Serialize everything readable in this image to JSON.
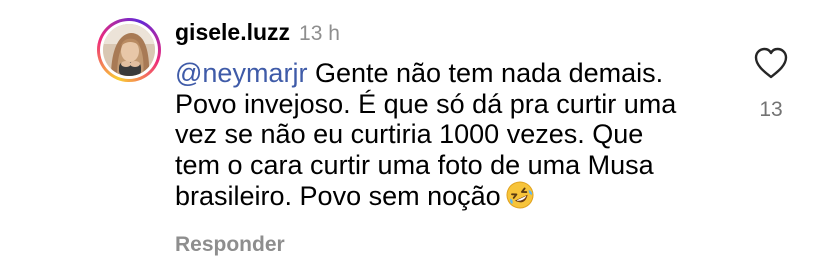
{
  "comment": {
    "username": "gisele.luzz",
    "time": "13 h",
    "mention": "@neymarjr",
    "body_line1": " Gente não tem nada demais.",
    "body_line2": "Povo invejoso. É que só dá pra curtir uma",
    "body_line3": "vez se não eu curtiria 1000 vezes. Que",
    "body_line4": "tem o cara curtir uma foto de uma Musa",
    "body_line5": "brasileiro. Povo sem noção",
    "emoji": "rolling-on-the-floor-laughing",
    "reply_label": "Responder",
    "like_count": "13",
    "like_icon": "heart-outline-icon",
    "story_ring_colors": [
      "#f9ce34",
      "#ee2a7b",
      "#6228d7"
    ]
  }
}
